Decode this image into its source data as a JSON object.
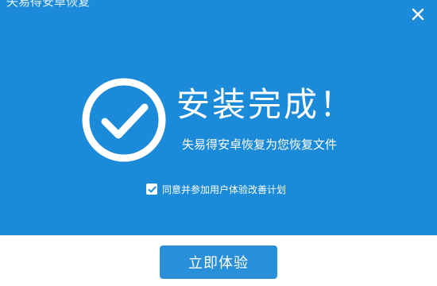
{
  "window": {
    "title": "失易得安卓恢复",
    "close_icon": "close-icon",
    "background_color": "#1b8ad8"
  },
  "result": {
    "status_icon": "check-circle-icon",
    "title": "安装完成！",
    "subtitle": "失易得安卓恢复为您恢复文件"
  },
  "agreement": {
    "checked": true,
    "label": "同意并参加用户体验改善计划"
  },
  "footer": {
    "button_label": "立即体验",
    "button_color": "#2a8fd9"
  }
}
